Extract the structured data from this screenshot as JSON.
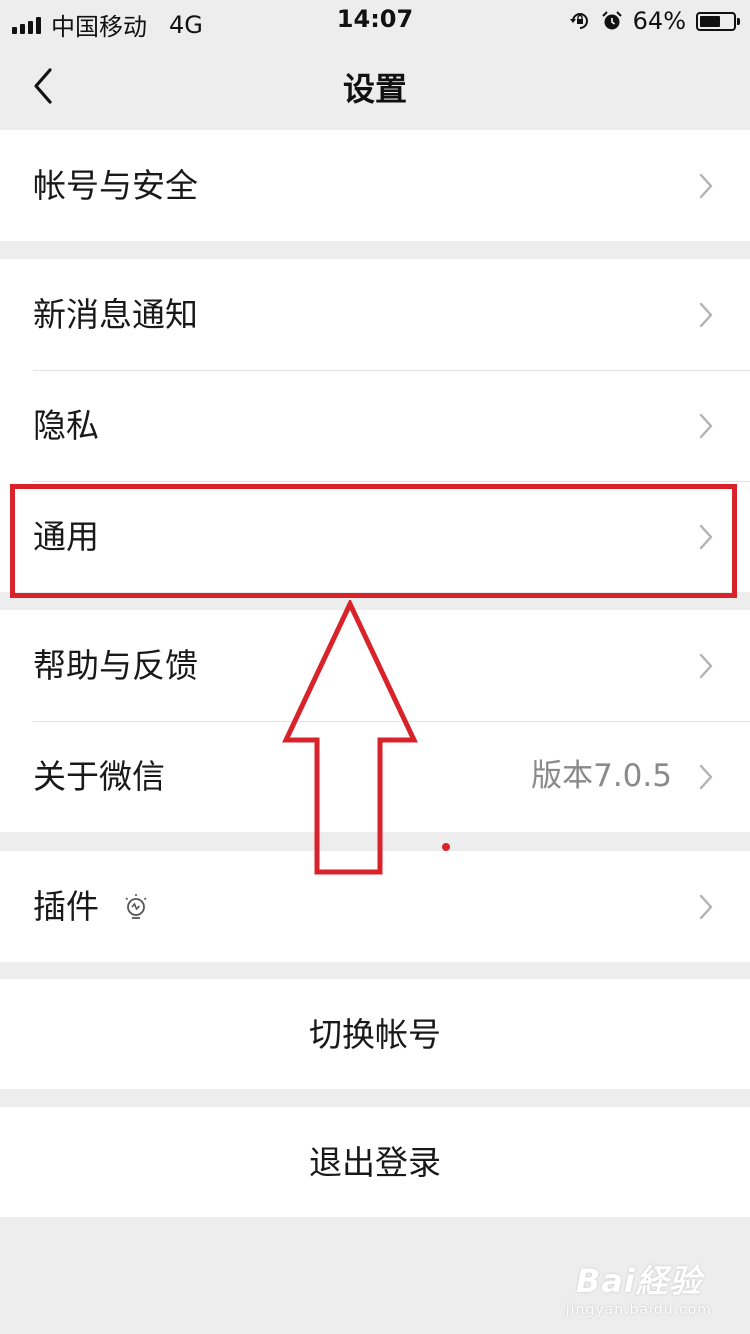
{
  "status_bar": {
    "carrier": "中国移动",
    "network": "4G",
    "time": "14:07",
    "battery_percent": "64%",
    "battery_level": 0.64
  },
  "nav": {
    "title": "设置"
  },
  "groups": {
    "account": {
      "security_label": "帐号与安全"
    },
    "settings": {
      "notifications_label": "新消息通知",
      "privacy_label": "隐私",
      "general_label": "通用",
      "feedback_label": "帮助与反馈",
      "about_label": "关于微信",
      "about_version": "版本7.0.5"
    },
    "plugins": {
      "plugins_label": "插件"
    },
    "actions": {
      "switch_account_label": "切换帐号",
      "logout_label": "退出登录"
    }
  },
  "annotation": {
    "accent_color": "#d9232b",
    "highlighted_item": "通用"
  },
  "watermark": {
    "main": "Bai経验",
    "sub": "jingyan.baidu.com"
  }
}
